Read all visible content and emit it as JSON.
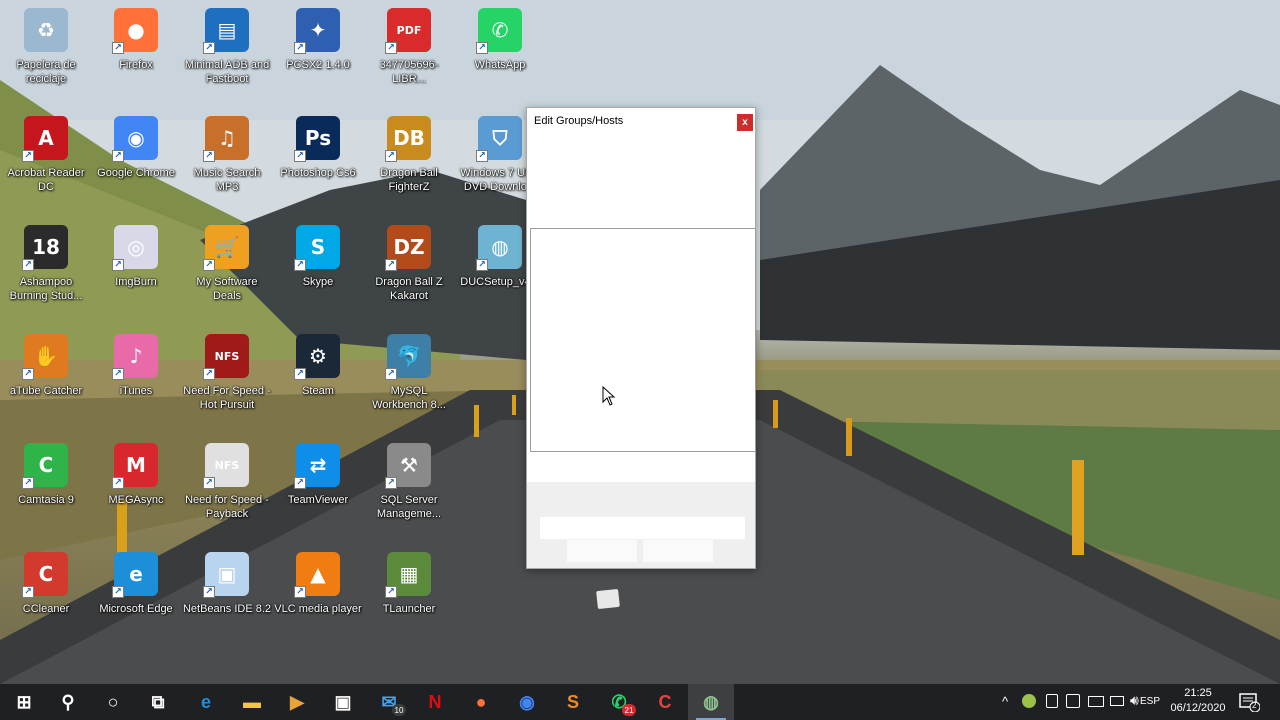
{
  "desktop": {
    "icons": [
      {
        "label": "Papelera de reciclaje",
        "icon": "recycle-bin-icon",
        "color": "#9ab8d0",
        "glyph": "♻"
      },
      {
        "label": "Firefox",
        "icon": "firefox-icon",
        "color": "#ff7139",
        "glyph": "●"
      },
      {
        "label": "Minimal ADB and Fastboot",
        "icon": "adb-icon",
        "color": "#1f6fc1",
        "glyph": "▤"
      },
      {
        "label": "PCSX2 1.4.0",
        "icon": "pcsx2-icon",
        "color": "#2f5fb0",
        "glyph": "✦"
      },
      {
        "label": "347705696-LIBR...",
        "icon": "pdf-file-icon",
        "color": "#d92b2b",
        "glyph": "PDF"
      },
      {
        "label": "WhatsApp",
        "icon": "whatsapp-icon",
        "color": "#25d366",
        "glyph": "✆"
      },
      {
        "label": "Acrobat Reader DC",
        "icon": "acrobat-icon",
        "color": "#c4161c",
        "glyph": "A"
      },
      {
        "label": "Google Chrome",
        "icon": "chrome-icon",
        "color": "#4285f4",
        "glyph": "◉"
      },
      {
        "label": "Music Search MP3",
        "icon": "music-search-icon",
        "color": "#c8702a",
        "glyph": "♫"
      },
      {
        "label": "Photoshop Cs6",
        "icon": "photoshop-icon",
        "color": "#0a2a5a",
        "glyph": "Ps"
      },
      {
        "label": "Dragon Ball FighterZ",
        "icon": "dragon-ball-fighterz-icon",
        "color": "#c98a1e",
        "glyph": "DB"
      },
      {
        "label": "Windows 7 USB DVD Downlo...",
        "icon": "windows-usb-icon",
        "color": "#5a9bd4",
        "glyph": "⛉"
      },
      {
        "label": "Ashampoo Burning Stud...",
        "icon": "ashampoo-icon",
        "color": "#2b2b2b",
        "glyph": "18"
      },
      {
        "label": "ImgBurn",
        "icon": "imgburn-icon",
        "color": "#d8d8e8",
        "glyph": "◎"
      },
      {
        "label": "My Software Deals",
        "icon": "cart-icon",
        "color": "#f0a020",
        "glyph": "🛒"
      },
      {
        "label": "Skype",
        "icon": "skype-icon",
        "color": "#00a8e6",
        "glyph": "S"
      },
      {
        "label": "Dragon Ball Z Kakarot",
        "icon": "dragon-ball-kakarot-icon",
        "color": "#b34a1a",
        "glyph": "DZ"
      },
      {
        "label": "DUCSetup_v4...",
        "icon": "duc-setup-icon",
        "color": "#6fb3d2",
        "glyph": "◍"
      },
      {
        "label": "aTube Catcher",
        "icon": "atube-catcher-icon",
        "color": "#e07a20",
        "glyph": "✋"
      },
      {
        "label": "iTunes",
        "icon": "itunes-icon",
        "color": "#e86aa8",
        "glyph": "♪"
      },
      {
        "label": "Need For Speed - Hot Pursuit",
        "icon": "nfs-hot-pursuit-icon",
        "color": "#a01a1a",
        "glyph": "NFS"
      },
      {
        "label": "Steam",
        "icon": "steam-icon",
        "color": "#1b2838",
        "glyph": "⚙"
      },
      {
        "label": "MySQL Workbench 8...",
        "icon": "mysql-workbench-icon",
        "color": "#3d7fa6",
        "glyph": "🐬"
      },
      {
        "label": "Camtasia 9",
        "icon": "camtasia-icon",
        "color": "#2fb44a",
        "glyph": "C"
      },
      {
        "label": "MEGAsync",
        "icon": "megasync-icon",
        "color": "#d9272e",
        "glyph": "M"
      },
      {
        "label": "Need for Speed - Payback",
        "icon": "nfs-payback-icon",
        "color": "#e0e0e0",
        "glyph": "NFS"
      },
      {
        "label": "TeamViewer",
        "icon": "teamviewer-icon",
        "color": "#0e8ee9",
        "glyph": "⇄"
      },
      {
        "label": "SQL Server Manageme...",
        "icon": "sql-server-icon",
        "color": "#8a8a8a",
        "glyph": "⚒"
      },
      {
        "label": "CCleaner",
        "icon": "ccleaner-icon",
        "color": "#d23a2e",
        "glyph": "C"
      },
      {
        "label": "Microsoft Edge",
        "icon": "edge-icon",
        "color": "#1d8fd8",
        "glyph": "e"
      },
      {
        "label": "NetBeans IDE 8.2",
        "icon": "netbeans-icon",
        "color": "#b8d4ee",
        "glyph": "▣"
      },
      {
        "label": "VLC media player",
        "icon": "vlc-icon",
        "color": "#f07c12",
        "glyph": "▲"
      },
      {
        "label": "TLauncher",
        "icon": "tlauncher-icon",
        "color": "#5a8a3a",
        "glyph": "▦"
      }
    ]
  },
  "dialog": {
    "title": "Edit Groups/Hosts",
    "close_label": "x"
  },
  "taskbar": {
    "apps": [
      {
        "name": "start-button",
        "glyph": "⊞",
        "color": "#ffffff"
      },
      {
        "name": "search-button",
        "glyph": "⚲",
        "color": "#ffffff"
      },
      {
        "name": "cortana-button",
        "glyph": "○",
        "color": "#ffffff"
      },
      {
        "name": "task-view-button",
        "glyph": "⧉",
        "color": "#ffffff"
      },
      {
        "name": "taskbar-edge",
        "glyph": "e",
        "color": "#1d8fd8"
      },
      {
        "name": "taskbar-file-explorer",
        "glyph": "▬",
        "color": "#f4c542"
      },
      {
        "name": "taskbar-media",
        "glyph": "▶",
        "color": "#e8a23a"
      },
      {
        "name": "taskbar-store",
        "glyph": "▣",
        "color": "#ffffff"
      },
      {
        "name": "taskbar-mail",
        "glyph": "✉",
        "color": "#4aa3e8",
        "badge": "10",
        "badge_color": "#3b3b3b"
      },
      {
        "name": "taskbar-netflix",
        "glyph": "N",
        "color": "#e50914"
      },
      {
        "name": "taskbar-firefox",
        "glyph": "●",
        "color": "#ff7139"
      },
      {
        "name": "taskbar-chrome",
        "glyph": "◉",
        "color": "#4285f4"
      },
      {
        "name": "taskbar-sublime",
        "glyph": "S",
        "color": "#f08a24"
      },
      {
        "name": "taskbar-whatsapp",
        "glyph": "✆",
        "color": "#25d366",
        "badge": "21",
        "badge_color": "#d9272e"
      },
      {
        "name": "taskbar-ccleaner",
        "glyph": "C",
        "color": "#e5443a"
      },
      {
        "name": "taskbar-active-app",
        "glyph": "◍",
        "color": "#8cc08a",
        "active": true
      }
    ],
    "tray": {
      "chevron": "^",
      "language": "ESP",
      "time": "21:25",
      "date": "06/12/2020",
      "notification_count": "2"
    }
  }
}
